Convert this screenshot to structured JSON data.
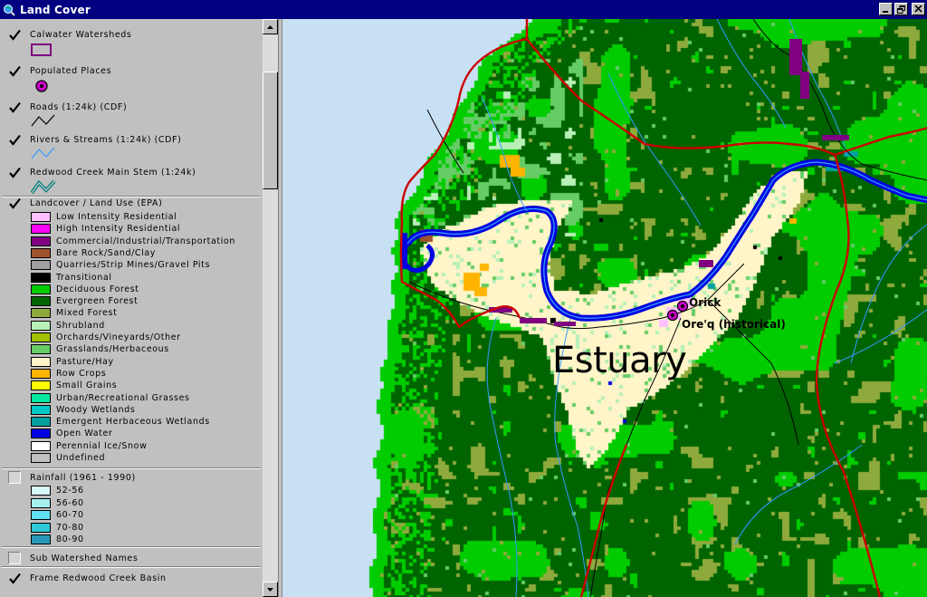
{
  "window": {
    "title": "Land Cover",
    "app_icon": "globe-magnifier-icon",
    "controls": [
      "minimize-icon",
      "restore-icon",
      "close-icon"
    ]
  },
  "toc": {
    "layers": [
      {
        "id": "calwater",
        "name": "Calwater Watersheds",
        "checked": true,
        "symbol": "polygon-outline",
        "color": "#800080"
      },
      {
        "id": "places",
        "name": "Populated Places",
        "checked": true,
        "symbol": "point",
        "color": "#cc00cc"
      },
      {
        "id": "roads",
        "name": "Roads (1:24k) (CDF)",
        "checked": true,
        "symbol": "line",
        "color": "#000000"
      },
      {
        "id": "rivers",
        "name": "Rivers & Streams (1:24k) (CDF)",
        "checked": true,
        "symbol": "line",
        "color": "#3399ff"
      },
      {
        "id": "mainstem",
        "name": "Redwood Creek Main Stem (1:24k)",
        "checked": true,
        "symbol": "double-line",
        "color": "#008080"
      },
      {
        "id": "landcover",
        "name": "Landcover / Land Use (EPA)",
        "checked": true,
        "symbol": "legend"
      },
      {
        "id": "rainfall",
        "name": "Rainfall (1961 - 1990)",
        "checked": false,
        "symbol": "legend"
      },
      {
        "id": "subwatershed",
        "name": "Sub Watershed Names",
        "checked": false,
        "symbol": "none"
      },
      {
        "id": "frame",
        "name": "Frame Redwood Creek Basin",
        "checked": true,
        "symbol": "none"
      }
    ],
    "landcover_legend": [
      {
        "label": "Low Intensity Residential",
        "color": "#ffc0ff"
      },
      {
        "label": "High Intensity Residential",
        "color": "#ff00ff"
      },
      {
        "label": "Commercial/Industrial/Transportation",
        "color": "#800080"
      },
      {
        "label": "Bare Rock/Sand/Clay",
        "color": "#a0522d"
      },
      {
        "label": "Quarries/Strip Mines/Gravel Pits",
        "color": "#a0a0a0"
      },
      {
        "label": "Transitional",
        "color": "#000000"
      },
      {
        "label": "Deciduous Forest",
        "color": "#00cc00"
      },
      {
        "label": "Evergreen Forest",
        "color": "#006400"
      },
      {
        "label": "Mixed Forest",
        "color": "#8faa3c"
      },
      {
        "label": "Shrubland",
        "color": "#b8f0b8"
      },
      {
        "label": "Orchards/Vineyards/Other",
        "color": "#a0c000"
      },
      {
        "label": "Grasslands/Herbaceous",
        "color": "#66cc66"
      },
      {
        "label": "Pasture/Hay",
        "color": "#fff5c8"
      },
      {
        "label": "Row Crops",
        "color": "#ffb400"
      },
      {
        "label": "Small Grains",
        "color": "#ffff00"
      },
      {
        "label": "Urban/Recreational Grasses",
        "color": "#00e8a0"
      },
      {
        "label": "Woody Wetlands",
        "color": "#00c8c8"
      },
      {
        "label": "Emergent Herbaceous Wetlands",
        "color": "#00a0a0"
      },
      {
        "label": "Open Water",
        "color": "#0000e0"
      },
      {
        "label": "Perennial Ice/Snow",
        "color": "#ffffff"
      },
      {
        "label": "Undefined",
        "color": "#c0c0c0"
      }
    ],
    "rainfall_legend": [
      {
        "label": "52-56",
        "color": "#d8f8f8"
      },
      {
        "label": "56-60",
        "color": "#a8f0f0"
      },
      {
        "label": "60-70",
        "color": "#60e0f0"
      },
      {
        "label": "70-80",
        "color": "#30c8d8"
      },
      {
        "label": "80-90",
        "color": "#2898b8"
      }
    ]
  },
  "map": {
    "places": [
      {
        "name": "Orick",
        "symbol": "point"
      },
      {
        "name": "Ore'q (historical)",
        "symbol": "point"
      }
    ],
    "area_label": "Estuary",
    "colors": {
      "ocean": "#c8e0f4",
      "watershed_boundary": "#cc0000",
      "channel": "#0000e0",
      "stream": "#3399ff",
      "road": "#000000"
    }
  }
}
